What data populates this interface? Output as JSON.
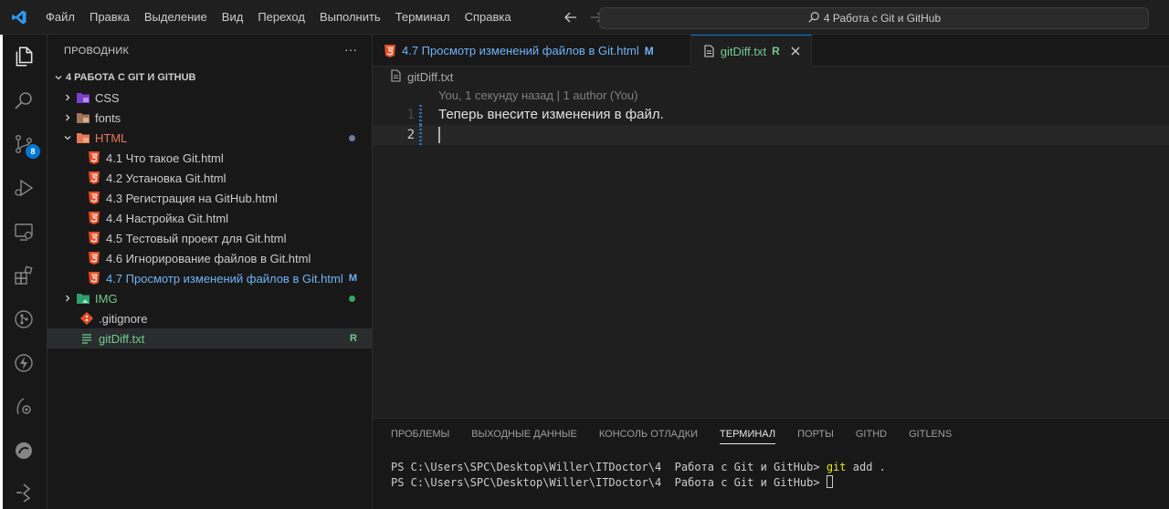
{
  "menu": [
    "Файл",
    "Правка",
    "Выделение",
    "Вид",
    "Переход",
    "Выполнить",
    "Терминал",
    "Справка"
  ],
  "search": {
    "text": "4 Работа с Git и GitHub"
  },
  "scm_badge": "8",
  "explorer": {
    "title": "ПРОВОДНИК",
    "more": "···",
    "workspace": "4 РАБОТА С GIT И GITHUB",
    "items": [
      {
        "label": "CSS",
        "kind": "folder",
        "icon": "css-folder-icon"
      },
      {
        "label": "fonts",
        "kind": "folder",
        "icon": "fonts-folder-icon"
      },
      {
        "label": "HTML",
        "kind": "folder-open",
        "icon": "html-folder-icon"
      },
      {
        "label": "4.1 Что такое Git.html",
        "kind": "html"
      },
      {
        "label": "4.2 Установка Git.html",
        "kind": "html"
      },
      {
        "label": "4.3 Регистрация на GitHub.html",
        "kind": "html"
      },
      {
        "label": "4.4 Настройка Git.html",
        "kind": "html"
      },
      {
        "label": "4.5 Тестовый проект для Git.html",
        "kind": "html"
      },
      {
        "label": "4.6 Игнорирование файлов в Git.html",
        "kind": "html"
      },
      {
        "label": "4.7 Просмотр изменений файлов в Git.html",
        "kind": "html",
        "badge": "M"
      },
      {
        "label": "IMG",
        "kind": "folder",
        "icon": "img-folder-icon"
      },
      {
        "label": ".gitignore",
        "kind": "git"
      },
      {
        "label": "gitDiff.txt",
        "kind": "txt",
        "badge": "R"
      }
    ]
  },
  "tabs": [
    {
      "label": "4.7 Просмотр изменений файлов в Git.html",
      "badge": "M"
    },
    {
      "label": "gitDiff.txt",
      "badge": "R"
    }
  ],
  "breadcrumb": "gitDiff.txt",
  "blame": "You, 1 секунду назад | 1 author (You)",
  "lines": [
    {
      "num": "1",
      "text": "Теперь внесите изменения в файл."
    },
    {
      "num": "2",
      "text": ""
    }
  ],
  "panel_tabs": [
    "ПРОБЛЕМЫ",
    "ВЫХОДНЫЕ ДАННЫЕ",
    "КОНСОЛЬ ОТЛАДКИ",
    "ТЕРМИНАЛ",
    "ПОРТЫ",
    "GITHD",
    "GITLENS"
  ],
  "terminal": {
    "prompt1": "PS C:\\Users\\SPC\\Desktop\\Willer\\ITDoctor\\4  Работа с Git и GitHub> ",
    "cmd1": "git",
    "args1": " add .",
    "prompt2": "PS C:\\Users\\SPC\\Desktop\\Willer\\ITDoctor\\4  Работа с Git и GitHub> "
  },
  "colors": {
    "accent": "#0078d4",
    "modified": "#6fb3f7",
    "renamed": "#73c991",
    "html": "#e44d26"
  }
}
